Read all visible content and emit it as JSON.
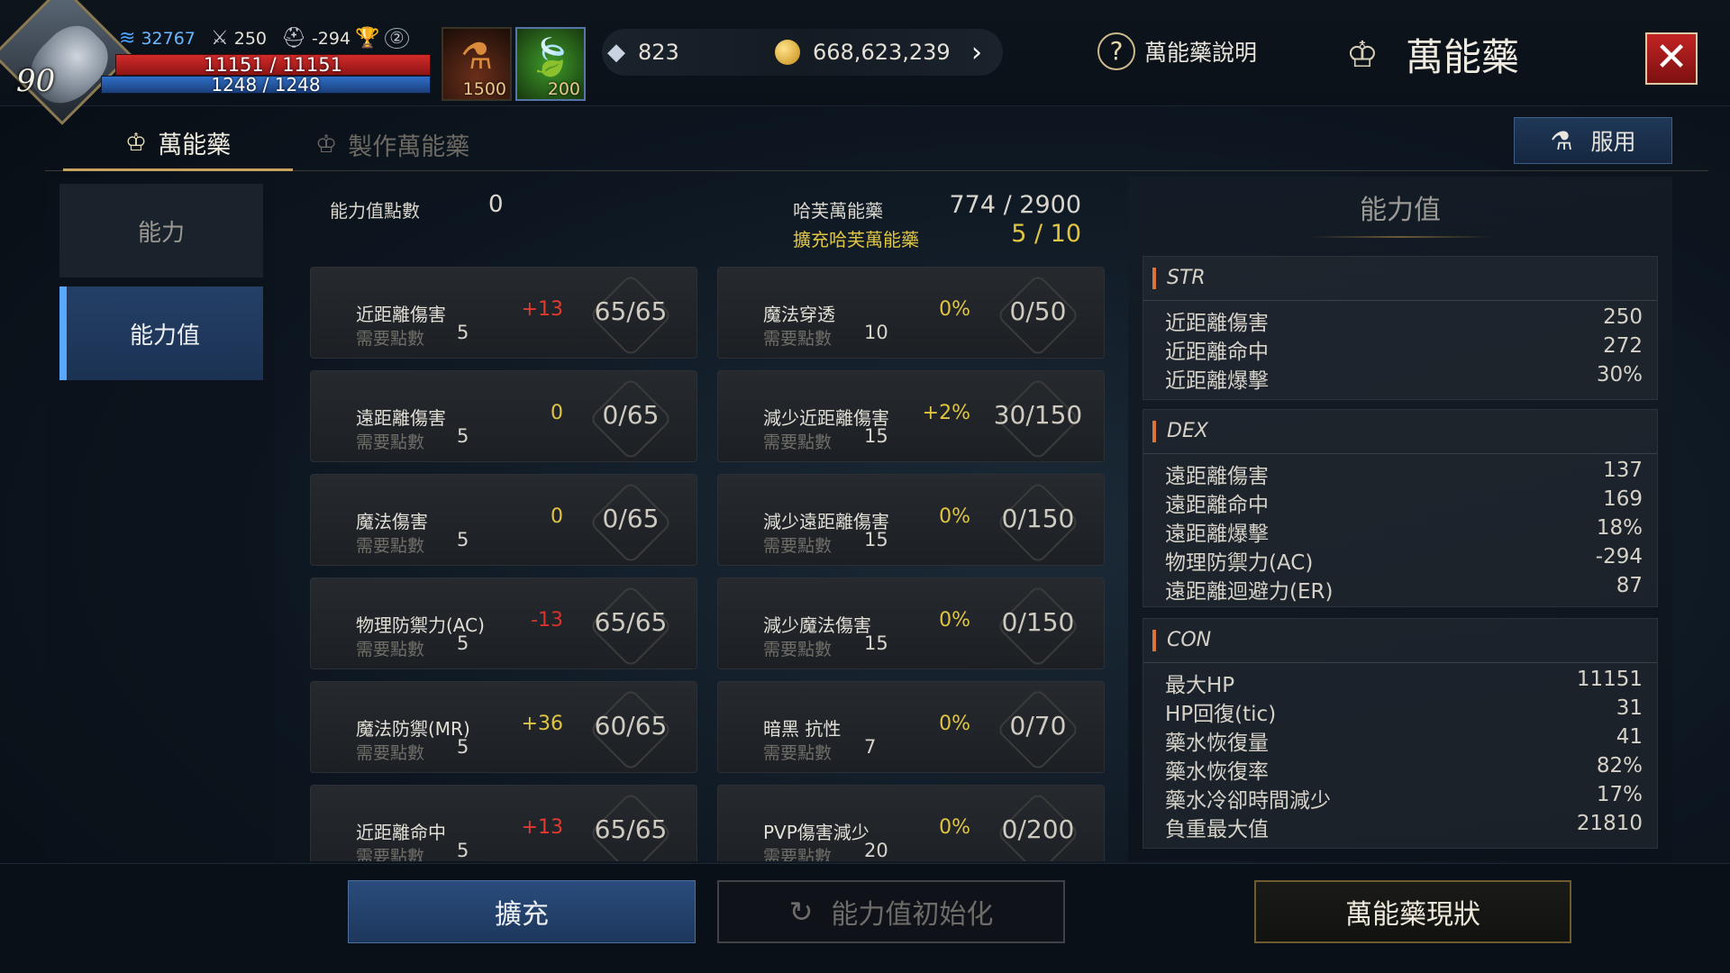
{
  "hud": {
    "level": "90",
    "gauge": "32767",
    "attack": "250",
    "defense": "-294",
    "hp": "11151 / 11151",
    "mp": "1248 / 1248",
    "slot1_count": "1500",
    "slot2_count": "200",
    "crystals": "823",
    "gold": "668,623,239",
    "help_label": "萬能藥說明",
    "title": "萬能藥"
  },
  "tabs": [
    {
      "label": "萬能藥",
      "active": true
    },
    {
      "label": "製作萬能藥",
      "active": false
    }
  ],
  "use_button": "服用",
  "sidenav": [
    {
      "label": "能力",
      "active": false
    },
    {
      "label": "能力值",
      "active": true
    }
  ],
  "header": {
    "points_label": "能力值點數",
    "points_value": "0",
    "hf_label": "哈芙萬能藥",
    "hf_value": "774 / 2900",
    "ext_label": "擴充哈芙萬能藥",
    "ext_value": "5 / 10"
  },
  "need_label": "需要點數",
  "cards_left": [
    {
      "name": "近距離傷害",
      "bonus": "+13",
      "bonus_type": "red",
      "progress": "65/65",
      "need": "5"
    },
    {
      "name": "遠距離傷害",
      "bonus": "0",
      "bonus_type": "zero",
      "progress": "0/65",
      "need": "5"
    },
    {
      "name": "魔法傷害",
      "bonus": "0",
      "bonus_type": "zero",
      "progress": "0/65",
      "need": "5"
    },
    {
      "name": "物理防禦力(AC)",
      "bonus": "-13",
      "bonus_type": "neg",
      "progress": "65/65",
      "need": "5"
    },
    {
      "name": "魔法防禦(MR)",
      "bonus": "+36",
      "bonus_type": "pos",
      "progress": "60/65",
      "need": "5"
    },
    {
      "name": "近距離命中",
      "bonus": "+13",
      "bonus_type": "red",
      "progress": "65/65",
      "need": "5"
    }
  ],
  "cards_right": [
    {
      "name": "魔法穿透",
      "bonus": "0%",
      "bonus_type": "zero",
      "progress": "0/50",
      "need": "10"
    },
    {
      "name": "減少近距離傷害",
      "bonus": "+2%",
      "bonus_type": "pos",
      "progress": "30/150",
      "need": "15"
    },
    {
      "name": "減少遠距離傷害",
      "bonus": "0%",
      "bonus_type": "zero",
      "progress": "0/150",
      "need": "15"
    },
    {
      "name": "減少魔法傷害",
      "bonus": "0%",
      "bonus_type": "zero",
      "progress": "0/150",
      "need": "15"
    },
    {
      "name": "暗黑 抗性",
      "bonus": "0%",
      "bonus_type": "zero",
      "progress": "0/70",
      "need": "7"
    },
    {
      "name": "PVP傷害減少",
      "bonus": "0%",
      "bonus_type": "zero",
      "progress": "0/200",
      "need": "20"
    }
  ],
  "stats_panel": {
    "title": "能力值",
    "groups": [
      {
        "head": "STR",
        "rows": [
          {
            "k": "近距離傷害",
            "v": "250"
          },
          {
            "k": "近距離命中",
            "v": "272"
          },
          {
            "k": "近距離爆擊",
            "v": "30%"
          }
        ]
      },
      {
        "head": "DEX",
        "rows": [
          {
            "k": "遠距離傷害",
            "v": "137"
          },
          {
            "k": "遠距離命中",
            "v": "169"
          },
          {
            "k": "遠距離爆擊",
            "v": "18%"
          },
          {
            "k": "物理防禦力(AC)",
            "v": "-294"
          },
          {
            "k": "遠距離迴避力(ER)",
            "v": "87"
          }
        ]
      },
      {
        "head": "CON",
        "rows": [
          {
            "k": "最大HP",
            "v": "11151"
          },
          {
            "k": "HP回復(tic)",
            "v": "31"
          },
          {
            "k": "藥水恢復量",
            "v": "41"
          },
          {
            "k": "藥水恢復率",
            "v": "82%"
          },
          {
            "k": "藥水冷卻時間減少",
            "v": "17%"
          },
          {
            "k": "負重最大值",
            "v": "21810"
          }
        ]
      }
    ]
  },
  "bottom": {
    "expand": "擴充",
    "reset": "能力值初始化",
    "status": "萬能藥現狀"
  }
}
